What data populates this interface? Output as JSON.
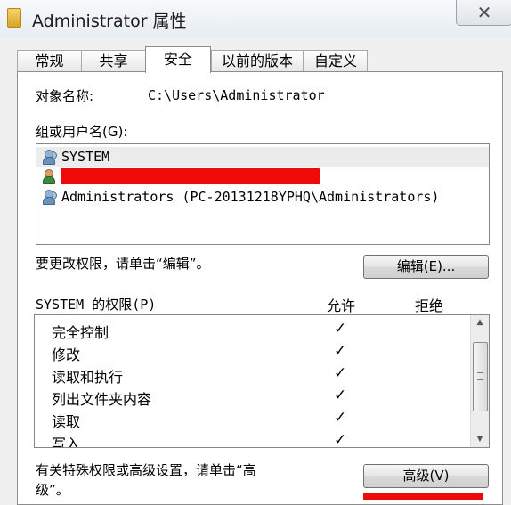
{
  "window": {
    "title": "Administrator 属性",
    "close_glyph": "✕"
  },
  "tabs": [
    {
      "label": "常规"
    },
    {
      "label": "共享"
    },
    {
      "label": "安全"
    },
    {
      "label": "以前的版本"
    },
    {
      "label": "自定义"
    }
  ],
  "security": {
    "object_name_label": "对象名称:",
    "object_name_value": "C:\\Users\\Administrator",
    "groups_label": "组或用户名(G):",
    "principals": [
      {
        "name": "SYSTEM",
        "icon": "group-icon"
      },
      {
        "name": "",
        "icon": "user-icon",
        "redacted": true
      },
      {
        "name": "Administrators (PC-20131218YPHQ\\Administrators)",
        "icon": "group-icon"
      }
    ],
    "edit_hint": "要更改权限，请单击“编辑”。",
    "edit_button": "编辑(E)...",
    "permissions_label": "SYSTEM 的权限(P)",
    "allow_header": "允许",
    "deny_header": "拒绝",
    "permissions": [
      {
        "name": "完全控制",
        "allow": "✓"
      },
      {
        "name": "修改",
        "allow": "✓"
      },
      {
        "name": "读取和执行",
        "allow": "✓"
      },
      {
        "name": "列出文件夹内容",
        "allow": "✓"
      },
      {
        "name": "读取",
        "allow": "✓"
      },
      {
        "name": "写入",
        "allow": "✓"
      }
    ],
    "advanced_hint_line1": "有关特殊权限或高级设置，请单击“高",
    "advanced_hint_line2": "级”。",
    "advanced_button": "高级(V)"
  },
  "colors": {
    "redaction": "#ee0a0a",
    "panel_bg": "#ffffff",
    "window_bg": "#f0f0f0"
  }
}
